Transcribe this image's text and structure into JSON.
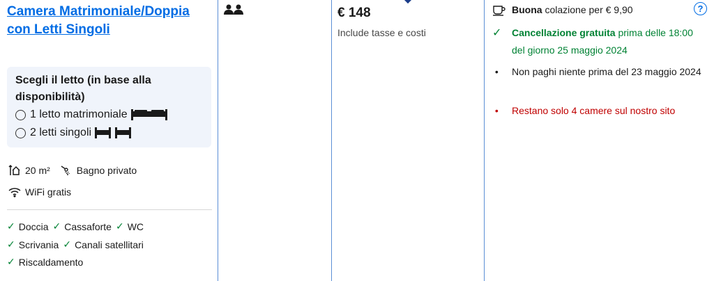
{
  "room": {
    "title": "Camera Matrimoniale/Doppia con Letti Singoli",
    "bed_choice": {
      "heading": "Scegli il letto (in base alla disponibilità)",
      "options": [
        {
          "label": "1 letto matrimoniale",
          "icon": "double-bed-icon"
        },
        {
          "label": "2 letti singoli",
          "icon": "twin-beds-icon"
        }
      ]
    },
    "size": "20 m²",
    "bathroom": "Bagno privato",
    "wifi": "WiFi gratis",
    "amenities": [
      [
        "Doccia",
        "Cassaforte",
        "WC"
      ],
      [
        "Scrivania",
        "Canali satellitari"
      ],
      [
        "Riscaldamento"
      ]
    ]
  },
  "price": {
    "amount": "€ 148",
    "note": "Include tasse e costi"
  },
  "conditions": {
    "breakfast_bold": "Buona",
    "breakfast_rest": " colazione per € 9,90",
    "cancellation_bold": "Cancellazione gratuita",
    "cancellation_rest": " prima delle 18:00 del giorno 25 maggio 2024",
    "payment": "Non paghi niente prima del 23 maggio 2024",
    "scarcity": "Restano solo 4 camere sul nostro sito",
    "help": "?"
  },
  "colors": {
    "link": "#006ce4",
    "green": "#008234",
    "red": "#c00000",
    "box_bg": "#f0f4fb",
    "column_line": "#5b8fd6"
  }
}
